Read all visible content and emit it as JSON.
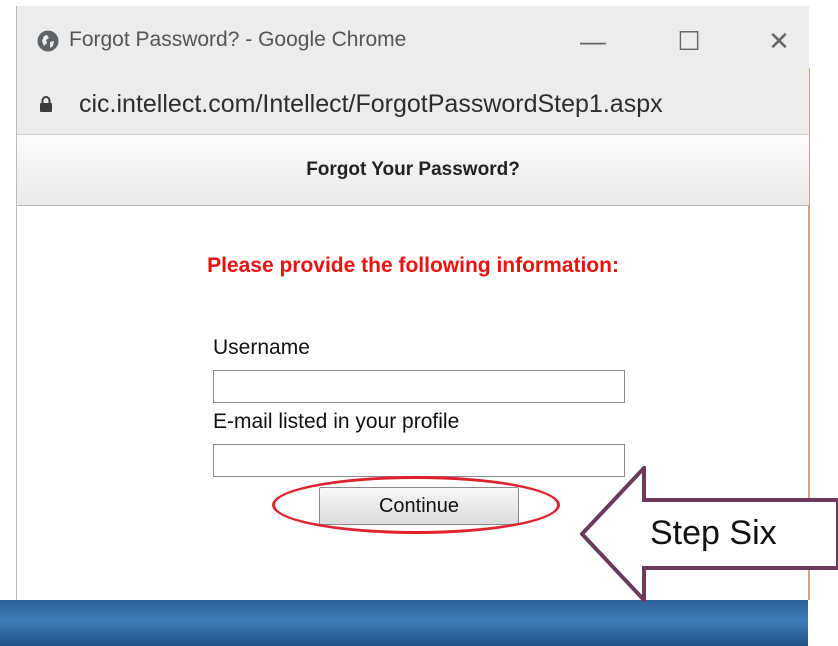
{
  "window": {
    "title": "Forgot Password? - Google Chrome",
    "minimize_glyph": "—",
    "maximize_glyph": "☐",
    "close_glyph": "✕"
  },
  "address_bar": {
    "url": "cic.intellect.com/Intellect/ForgotPasswordStep1.aspx",
    "icon": "lock-icon"
  },
  "page": {
    "header_title": "Forgot Your Password?",
    "prompt": "Please provide the following information:",
    "username_label": "Username",
    "username_value": "",
    "email_label": "E-mail listed in your profile",
    "email_value": "",
    "continue_label": "Continue"
  },
  "annotation": {
    "step_label": "Step Six",
    "highlight_color": "#e0222d",
    "arrow_color": "#6b3a5b"
  },
  "colors": {
    "prompt": "#ee1111",
    "titlebar": "#ececec"
  }
}
